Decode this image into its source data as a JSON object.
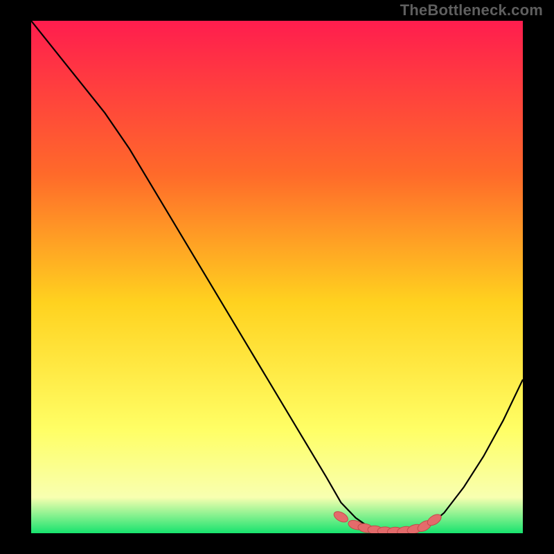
{
  "watermark": "TheBottleneck.com",
  "colors": {
    "bg": "#000000",
    "grad_top": "#ff1d4e",
    "grad_mid1": "#ff6a2a",
    "grad_mid2": "#ffd21f",
    "grad_mid3": "#ffff66",
    "grad_mid4": "#f8ffb0",
    "grad_bottom": "#17e36e",
    "curve": "#000000",
    "marker_fill": "#e46b6b",
    "marker_stroke": "#c44a4a"
  },
  "chart_data": {
    "type": "line",
    "title": "",
    "xlabel": "",
    "ylabel": "",
    "xlim": [
      0,
      100
    ],
    "ylim": [
      0,
      100
    ],
    "grid": false,
    "legend": false,
    "series": [
      {
        "name": "bottleneck-curve",
        "x": [
          0,
          5,
          10,
          15,
          20,
          25,
          30,
          35,
          40,
          45,
          50,
          55,
          60,
          63,
          66,
          69,
          72,
          75,
          78,
          81,
          84,
          88,
          92,
          96,
          100
        ],
        "y": [
          100,
          94,
          88,
          82,
          75,
          67,
          59,
          51,
          43,
          35,
          27,
          19,
          11,
          6,
          3,
          1,
          0.4,
          0.3,
          0.5,
          1.5,
          4,
          9,
          15,
          22,
          30
        ]
      }
    ],
    "markers": {
      "name": "optimal-range",
      "x": [
        63,
        66,
        68,
        70,
        72,
        74,
        76,
        78,
        80,
        82
      ],
      "y": [
        3.2,
        1.6,
        1.0,
        0.6,
        0.4,
        0.35,
        0.45,
        0.8,
        1.4,
        2.6
      ]
    }
  }
}
